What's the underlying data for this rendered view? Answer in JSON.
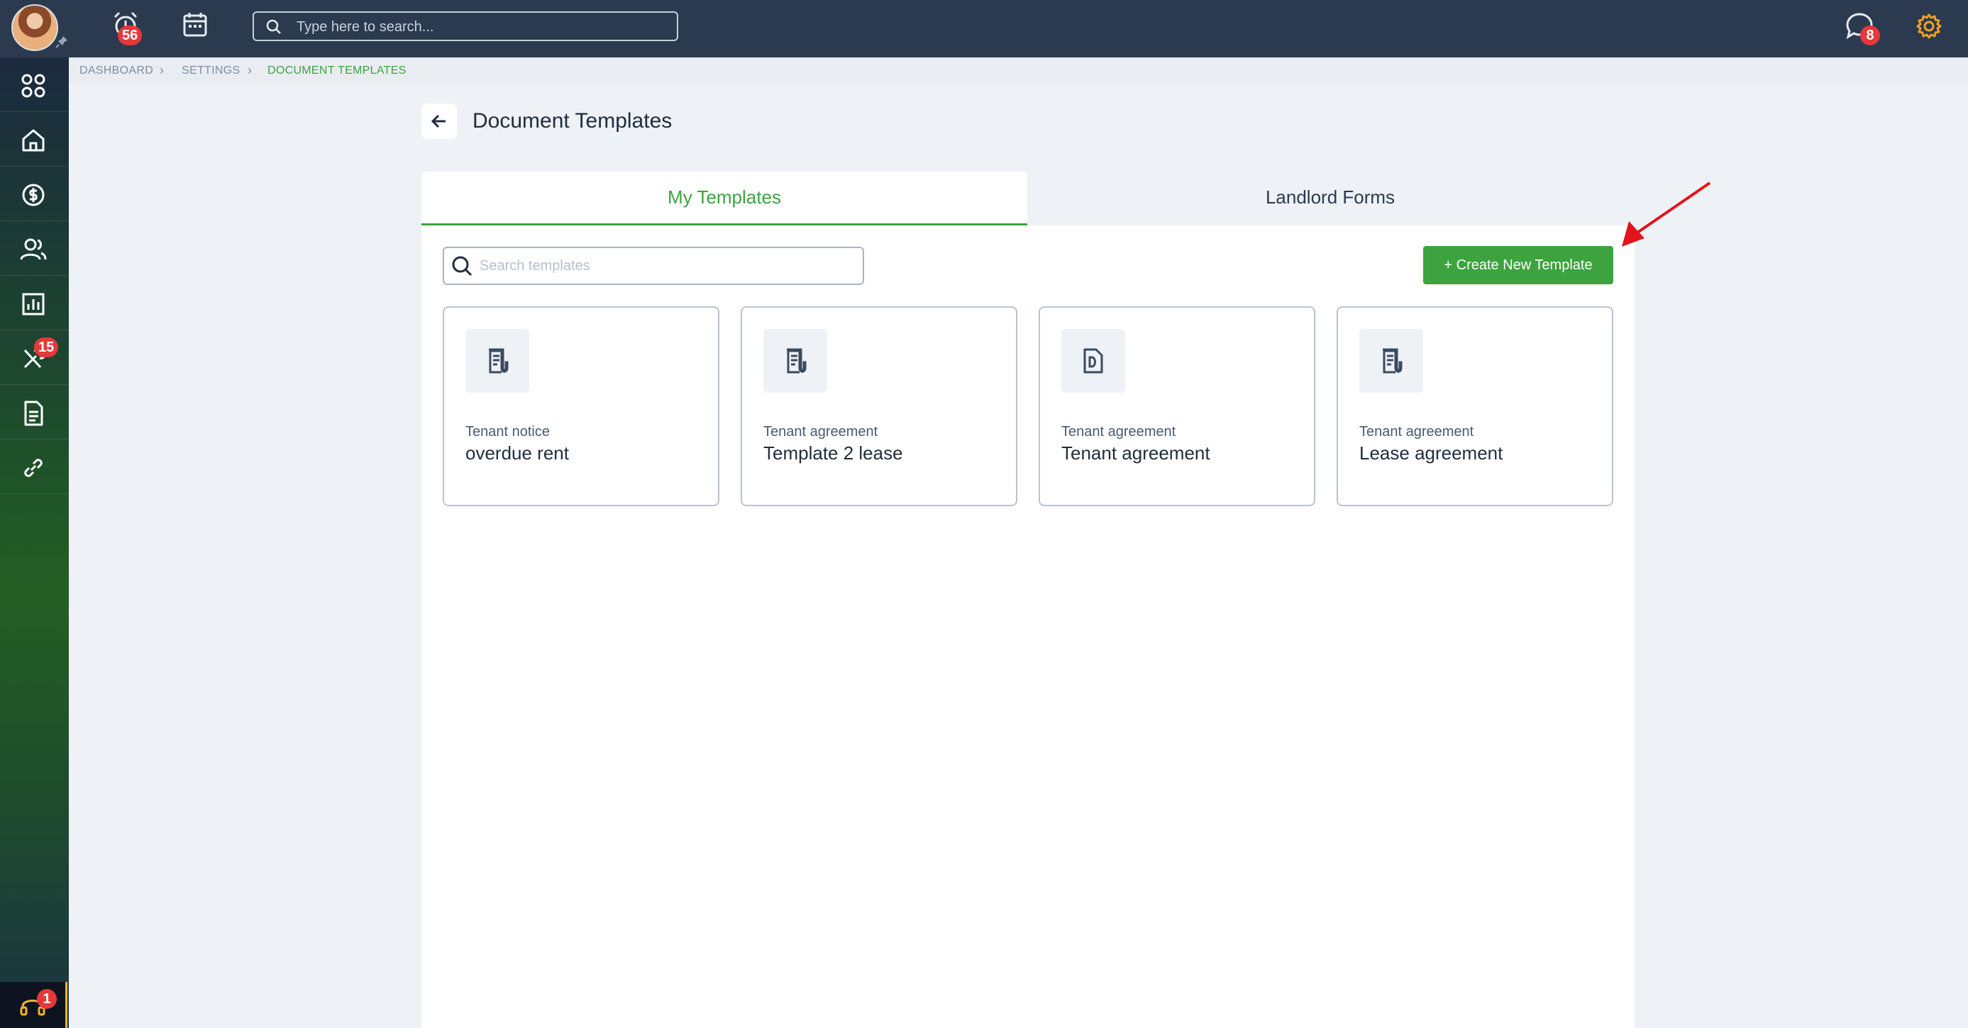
{
  "topbar": {
    "search_placeholder": "Type here to search...",
    "alerts_badge": "56",
    "messages_badge": "8"
  },
  "sidebar": {
    "maintenance_badge": "15",
    "help_badge": "1"
  },
  "breadcrumb": [
    "DASHBOARD",
    "SETTINGS",
    "DOCUMENT TEMPLATES"
  ],
  "page": {
    "title": "Document Templates"
  },
  "tabs": [
    {
      "label": "My Templates",
      "active": true
    },
    {
      "label": "Landlord Forms",
      "active": false
    }
  ],
  "templates_panel": {
    "search_placeholder": "Search templates",
    "create_button": "+ Create New Template"
  },
  "templates": [
    {
      "type": "Tenant notice",
      "name": "overdue rent",
      "icon": "document-lines-icon"
    },
    {
      "type": "Tenant agreement",
      "name": "Template 2 lease",
      "icon": "document-lines-icon"
    },
    {
      "type": "Tenant agreement",
      "name": "Tenant agreement",
      "icon": "document-pdf-icon"
    },
    {
      "type": "Tenant agreement",
      "name": "Lease agreement",
      "icon": "document-lines-icon"
    }
  ],
  "colors": {
    "topbar": "#2b3a4f",
    "accent_green": "#3ca33f",
    "badge_red": "#e5383b",
    "settings_orange": "#f3a023",
    "annotation_arrow": "#e3141b"
  }
}
